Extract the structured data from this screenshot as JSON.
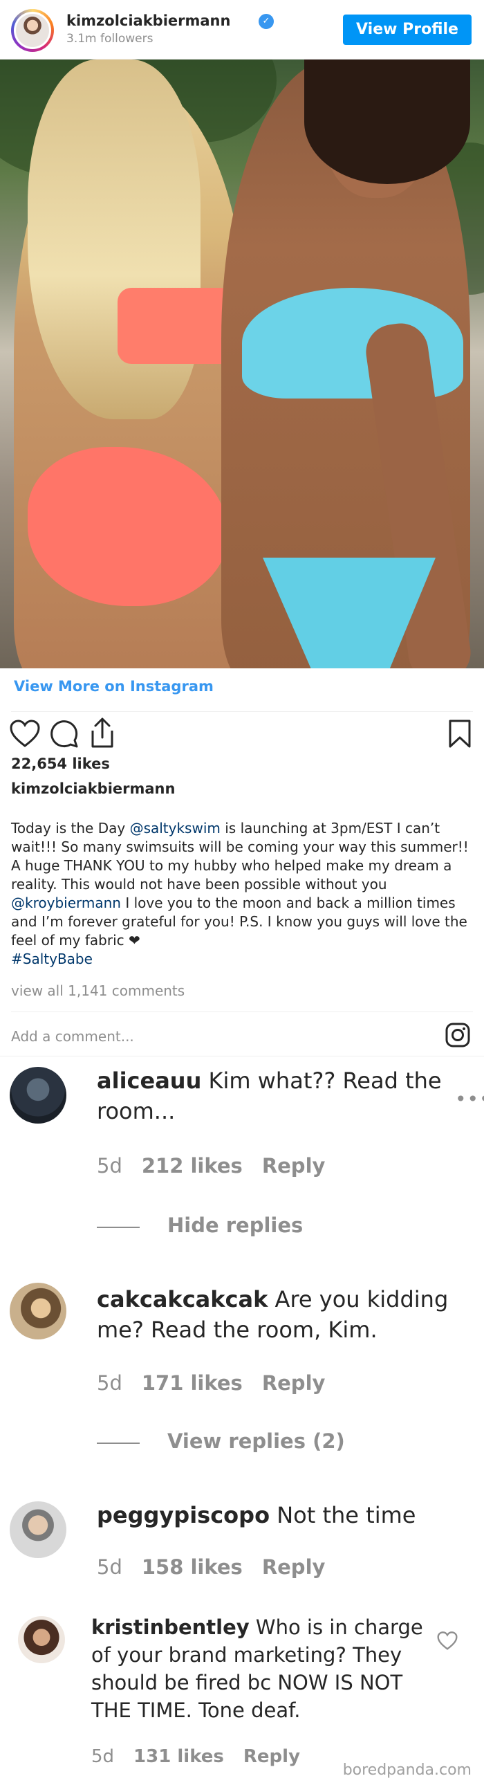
{
  "header": {
    "username": "kimzolciakbiermann",
    "followers": "3.1m followers",
    "view_profile": "View Profile"
  },
  "post": {
    "view_more": "View More on Instagram",
    "likes": "22,654 likes",
    "caption_user": "kimzolciakbiermann",
    "caption_parts": {
      "p1": "Today is the Day  ",
      "m1": "@saltykswim",
      "p2": " is launching at 3pm/EST I can’t wait!!! So many swimsuits will be coming your way this summer!! A huge THANK YOU to my hubby who helped make my dream a reality. This would not have been possible without you ",
      "m2": "@kroybiermann",
      "p3": " I love you to the moon and back a million times and I’m forever grateful for you! P.S. I know you guys will love the feel of my fabric ❤",
      "m3": "#SaltyBabe"
    },
    "view_all": "view all 1,141 comments",
    "add_comment": "Add a comment..."
  },
  "comments": [
    {
      "user": "aliceauu",
      "text": "Kim what?? Read the room...",
      "age": "5d",
      "likes": "212 likes",
      "reply": "Reply",
      "toggle": "Hide replies"
    },
    {
      "user": "cakcakcakcak",
      "text": "Are you kidding me? Read the room, Kim.",
      "age": "5d",
      "likes": "171 likes",
      "reply": "Reply",
      "toggle": "View replies (2)"
    },
    {
      "user": "peggypiscopo",
      "text": "Not the time",
      "age": "5d",
      "likes": "158 likes",
      "reply": "Reply"
    },
    {
      "user": "kristinbentley",
      "text": "Who is in charge of your brand marketing? They should be fired bc NOW IS NOT THE TIME. Tone deaf.",
      "age": "5d",
      "likes": "131 likes",
      "reply": "Reply"
    }
  ],
  "watermark": "boredpanda.com",
  "colors": {
    "link": "#3897f0",
    "button": "#0095f6",
    "mention": "#00376b",
    "muted": "#8e8e8e"
  },
  "icons": [
    "verified-icon",
    "heart-icon",
    "comment-icon",
    "share-icon",
    "bookmark-icon",
    "instagram-icon",
    "more-icon"
  ]
}
